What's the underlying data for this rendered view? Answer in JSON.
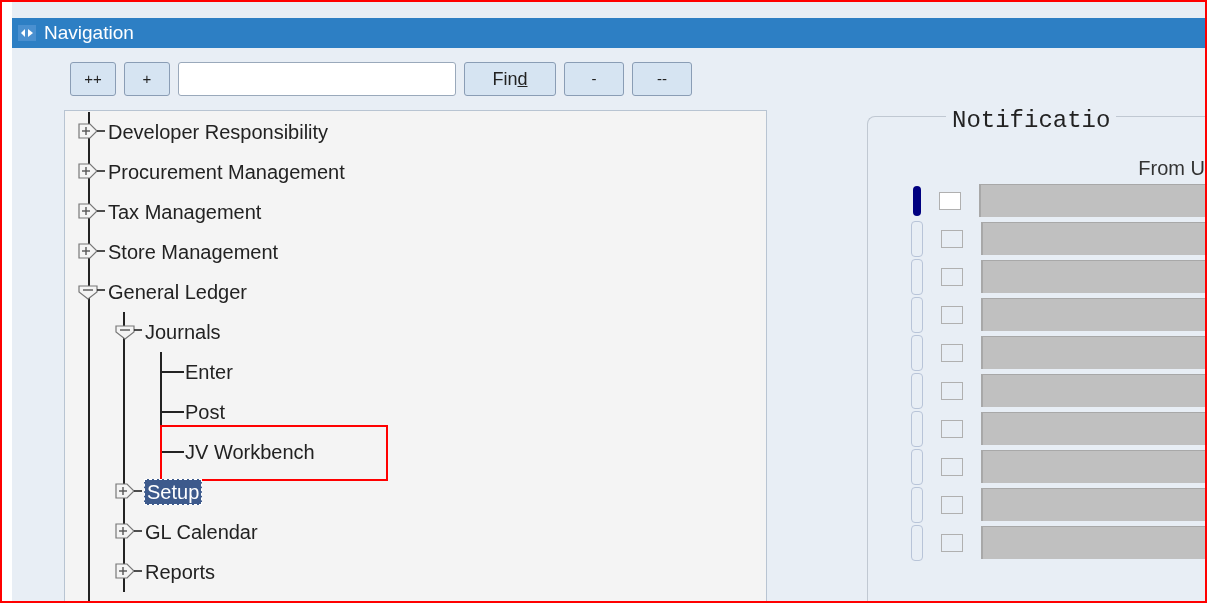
{
  "window": {
    "title": "Navigation"
  },
  "toolbar": {
    "buttons_left": [
      {
        "label": "++"
      },
      {
        "label": "+"
      }
    ],
    "find_button": {
      "label": "Find"
    },
    "buttons_right": [
      {
        "label": "-"
      },
      {
        "label": "--"
      }
    ]
  },
  "tree": [
    {
      "label": "Developer Responsibility",
      "kind": "branch",
      "expanded": false,
      "selected": false,
      "highlighted": false
    },
    {
      "label": "Procurement Management",
      "kind": "branch",
      "expanded": false,
      "selected": false,
      "highlighted": false
    },
    {
      "label": "Tax Management",
      "kind": "branch",
      "expanded": false,
      "selected": false,
      "highlighted": false
    },
    {
      "label": "Store Management",
      "kind": "branch",
      "expanded": false,
      "selected": false,
      "highlighted": false
    },
    {
      "label": "General Ledger",
      "kind": "branch",
      "expanded": true,
      "selected": false,
      "highlighted": false,
      "children": [
        {
          "label": "Journals",
          "kind": "branch",
          "expanded": true,
          "selected": false,
          "highlighted": false,
          "children": [
            {
              "label": "Enter",
              "kind": "leaf",
              "selected": false,
              "highlighted": false
            },
            {
              "label": "Post",
              "kind": "leaf",
              "selected": false,
              "highlighted": false
            },
            {
              "label": "JV Workbench",
              "kind": "leaf",
              "selected": false,
              "highlighted": true
            }
          ]
        },
        {
          "label": "Setup",
          "kind": "branch",
          "expanded": false,
          "selected": true,
          "highlighted": false
        },
        {
          "label": "GL Calendar",
          "kind": "branch",
          "expanded": false,
          "selected": false,
          "highlighted": false
        },
        {
          "label": "Reports",
          "kind": "branch",
          "expanded": false,
          "selected": false,
          "highlighted": false
        }
      ]
    }
  ],
  "notifications": {
    "title": "Notificatio",
    "column_header": "From U",
    "rows": [
      {
        "selected": true
      },
      {
        "selected": false
      },
      {
        "selected": false
      },
      {
        "selected": false
      },
      {
        "selected": false
      },
      {
        "selected": false
      },
      {
        "selected": false
      },
      {
        "selected": false
      },
      {
        "selected": false
      },
      {
        "selected": false
      }
    ]
  }
}
